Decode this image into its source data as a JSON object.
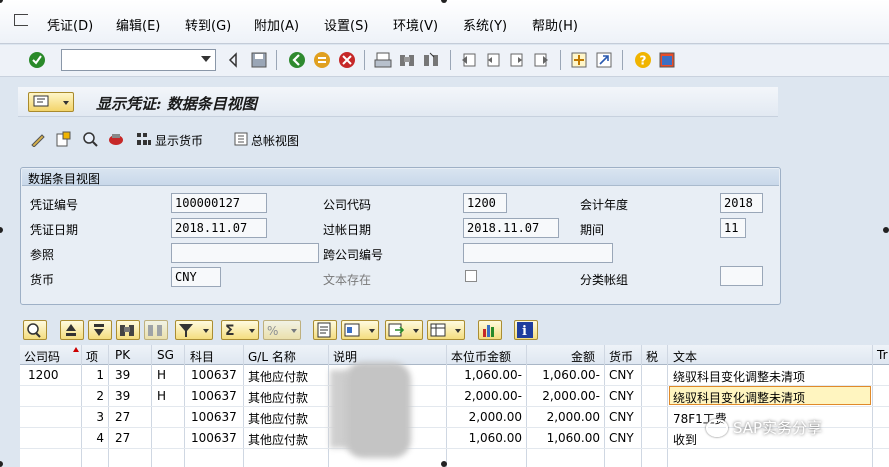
{
  "menu": {
    "items": [
      "凭证(D)",
      "编辑(E)",
      "转到(G)",
      "附加(A)",
      "设置(S)",
      "环境(V)",
      "系统(Y)",
      "帮助(H)"
    ]
  },
  "toolbar": {
    "command_value": ""
  },
  "page": {
    "title": "显示凭证: 数据条目视图"
  },
  "app_toolbar": {
    "display_currency": "显示货币",
    "gl_view": "总帐视图"
  },
  "header_group": {
    "title": "数据条目视图",
    "doc_no_label": "凭证编号",
    "doc_no": "100000127",
    "company_code_label": "公司代码",
    "company_code": "1200",
    "fiscal_year_label": "会计年度",
    "fiscal_year": "2018",
    "doc_date_label": "凭证日期",
    "doc_date": "2018.11.07",
    "posting_date_label": "过帐日期",
    "posting_date": "2018.11.07",
    "period_label": "期间",
    "period": "11",
    "reference_label": "参照",
    "reference": "",
    "cross_cc_label": "跨公司编号",
    "cross_cc": "",
    "currency_label": "货币",
    "currency": "CNY",
    "text_exists_label": "文本存在",
    "ledger_group_label": "分类帐组",
    "ledger_group": ""
  },
  "grid": {
    "columns": [
      "公司码",
      "项",
      "PK",
      "SG",
      "科目",
      "G/L 名称",
      "说明",
      "本位币金额",
      "金额",
      "货币",
      "税",
      "文本",
      "Tr"
    ],
    "rows": [
      {
        "cc": "1200",
        "item": "1",
        "pk": "39",
        "sg": "H",
        "account": "100637",
        "gl_name": "其他应付款",
        "desc": "",
        "local_amt": "1,060.00-",
        "amt": "1,060.00-",
        "cur": "CNY",
        "tax": "",
        "text": "绕驭科目变化调整未清项"
      },
      {
        "cc": "",
        "item": "2",
        "pk": "39",
        "sg": "H",
        "account": "100637",
        "gl_name": "其他应付款",
        "desc": "",
        "local_amt": "2,000.00-",
        "amt": "2,000.00-",
        "cur": "CNY",
        "tax": "",
        "text": "绕驭科目变化调整未清项"
      },
      {
        "cc": "",
        "item": "3",
        "pk": "27",
        "sg": "",
        "account": "100637",
        "gl_name": "其他应付款",
        "desc": "",
        "local_amt": "2,000.00",
        "amt": "2,000.00",
        "cur": "CNY",
        "tax": "",
        "text": "78F1工费"
      },
      {
        "cc": "",
        "item": "4",
        "pk": "27",
        "sg": "",
        "account": "100637",
        "gl_name": "其他应付款",
        "desc": "",
        "local_amt": "1,060.00",
        "amt": "1,060.00",
        "cur": "CNY",
        "tax": "",
        "text": "收到"
      }
    ]
  },
  "watermark": {
    "text": "SAP实务分享"
  },
  "colors": {
    "accent_yellow": "#f4dd7f",
    "highlight_border": "#e08a2a",
    "background": "#dde6f0"
  }
}
